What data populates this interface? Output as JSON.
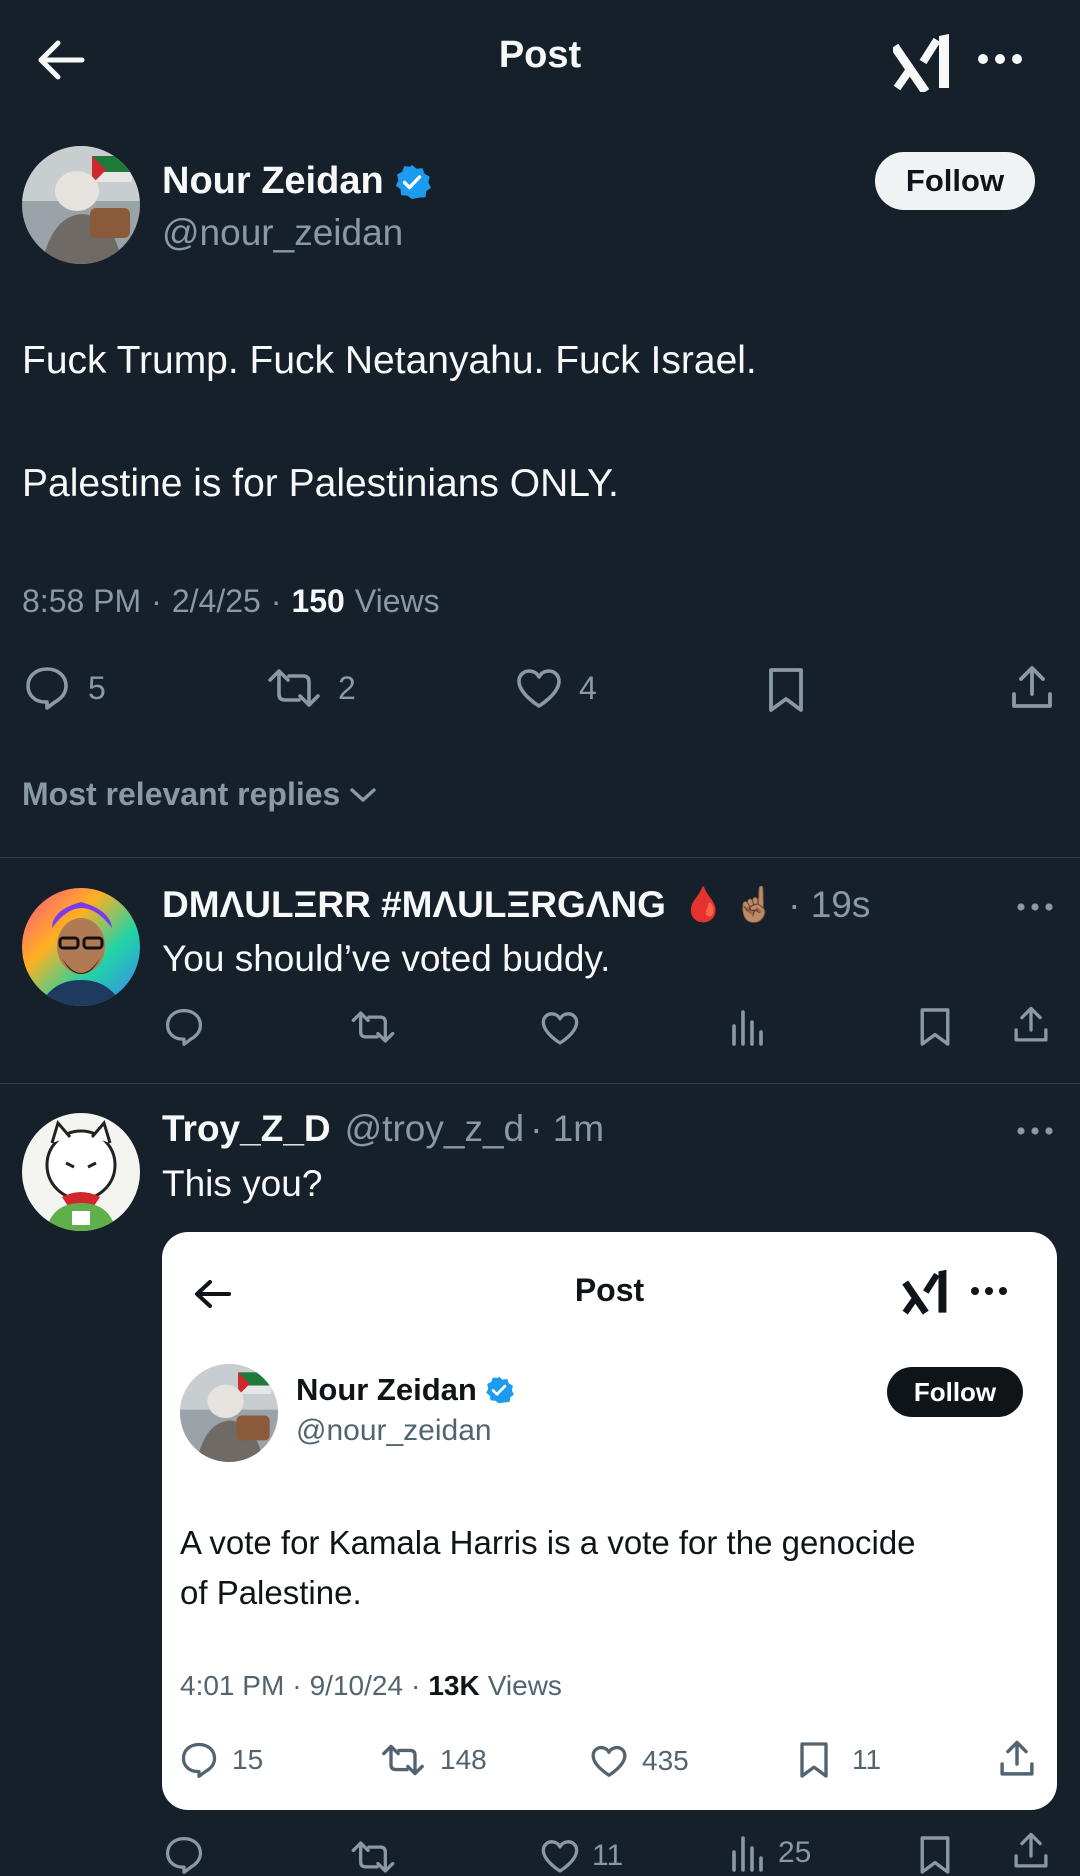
{
  "header": {
    "title": "Post"
  },
  "post": {
    "author_name": "Nour Zeidan",
    "author_handle": "@nour_zeidan",
    "follow_label": "Follow",
    "text_line1": "Fuck Trump. Fuck Netanyahu. Fuck Israel.",
    "text_line2": "Palestine is for Palestinians ONLY.",
    "meta": {
      "time": "8:58 PM",
      "date": "2/4/25",
      "views_count": "150",
      "views_label": "Views",
      "sep": "·"
    },
    "actions": {
      "replies": "5",
      "reposts": "2",
      "likes": "4"
    }
  },
  "replies_filter": {
    "label": "Most relevant replies"
  },
  "replies": [
    {
      "name": "DMΛULΞRR #MΛULΞRGΛNG",
      "emojis": "🩸 ☝🏽",
      "time": "· 19s",
      "text": "You should’ve voted buddy."
    },
    {
      "name": "Troy_Z_D",
      "handle": "@troy_z_d",
      "time": "· 1m",
      "text": "This you?",
      "actions": {
        "likes": "11",
        "views": "25"
      }
    }
  ],
  "quoted_screenshot": {
    "title": "Post",
    "author_name": "Nour Zeidan",
    "author_handle": "@nour_zeidan",
    "follow_label": "Follow",
    "text_line1": "A vote for Kamala Harris is a vote for the genocide",
    "text_line2": "of Palestine.",
    "meta": {
      "time": "4:01 PM",
      "date": "9/10/24",
      "views_count": "13K",
      "views_label": "Views",
      "sep": "·"
    },
    "actions": {
      "replies": "15",
      "reposts": "148",
      "likes": "435",
      "bookmarks": "11"
    }
  },
  "colors": {
    "background": "#15202b",
    "text": "#e7e9ea",
    "muted": "#8b98a5",
    "verified": "#1d9bf0",
    "divider": "#2f3b47"
  }
}
